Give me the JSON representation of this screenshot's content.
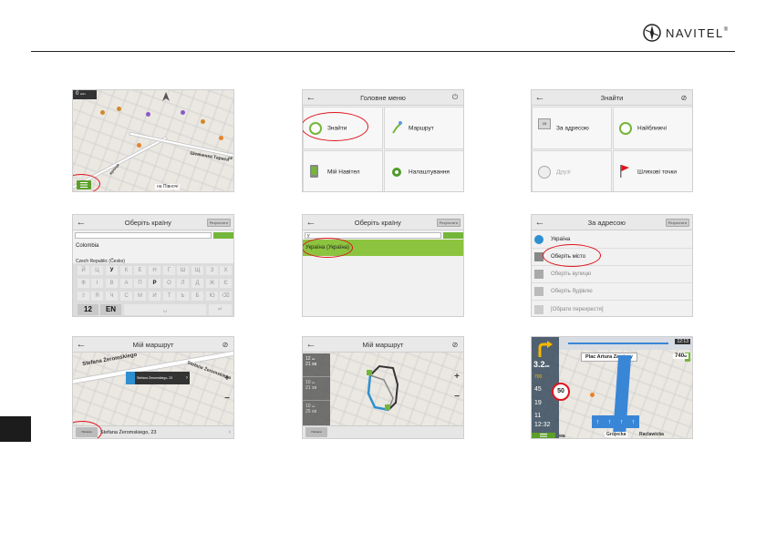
{
  "brand": {
    "name": "NAVITEL",
    "reg": "®"
  },
  "colors": {
    "accent_green": "#74b63a",
    "highlight_red": "#e0141e"
  },
  "s1": {
    "speed": "0",
    "speed_unit": "км/ч",
    "street1": "Шевченка Тараса",
    "street2": "вулиця",
    "place": "на Півночі",
    "street_suffix": "SE"
  },
  "s2": {
    "title": "Головне меню",
    "find": "Знайти",
    "route": "Маршрут",
    "my_navitel": "Мій Навітел",
    "settings": "Налаштування"
  },
  "s3": {
    "title": "Знайти",
    "by_address": "За адресою",
    "nearest": "Найближчі",
    "history": "Друзі",
    "favorites": "Шляхові точки",
    "badge": "15"
  },
  "s4": {
    "title": "Оберіть країну",
    "right_btn": "Результати",
    "item1": "Colombia",
    "item2": "Czech Republic (Česko)",
    "keys_row1": [
      "Й",
      "Ц",
      "У",
      "К",
      "Е",
      "Н",
      "Г",
      "Ш",
      "Щ",
      "З",
      "Х"
    ],
    "keys_row2": [
      "Ф",
      "І",
      "В",
      "А",
      "П",
      "Р",
      "О",
      "Л",
      "Д",
      "Ж",
      "Є"
    ],
    "keys_row3": [
      "Я",
      "Ч",
      "С",
      "М",
      "И",
      "Т",
      "Ь",
      "Б",
      "Ю"
    ],
    "num_key": "12",
    "lang_key": "EN"
  },
  "s5": {
    "title": "Оберіть країну",
    "right_btn": "Результати",
    "query": "у",
    "result": "Україна (Україна)"
  },
  "s6": {
    "title": "За адресою",
    "right_btn": "Результати",
    "country": "Україна",
    "city": "Оберіть місто",
    "street": "Оберіть вулицю",
    "house": "Оберіть будівлю",
    "cross": "[Обрати перехрестя]"
  },
  "s7": {
    "title": "Мій маршрут",
    "street1": "Stefana Żeromskiego",
    "street2": "Stefana Żeromskiego",
    "popup": "Stefana Żeromskiego, 23",
    "bottom": "Stefana Żeromskiego, 23",
    "go": "Поїхали"
  },
  "s8": {
    "title": "Мій маршрут",
    "r1_dist": "12",
    "r1_unit": "км",
    "r1_time": "21 хв",
    "r2_dist": "10",
    "r2_unit": "км",
    "r2_time": "21 хв",
    "r3_dist": "10",
    "r3_unit": "км",
    "r3_time": "25 хв",
    "go": "Поїхали"
  },
  "s9": {
    "time": "12:13",
    "next_street": "Plac Artura Zawiszy",
    "turn_dist": "3.2",
    "turn_unit": "км",
    "speed_limit": "50",
    "dist_right": "740",
    "dist_right_unit": "м",
    "d1": "700",
    "d2": "45",
    "d3": "19",
    "d4": "11",
    "eta": "12:32",
    "street_a": "Grójecka",
    "street_b": "Raclawicka",
    "street_c": "wa"
  }
}
